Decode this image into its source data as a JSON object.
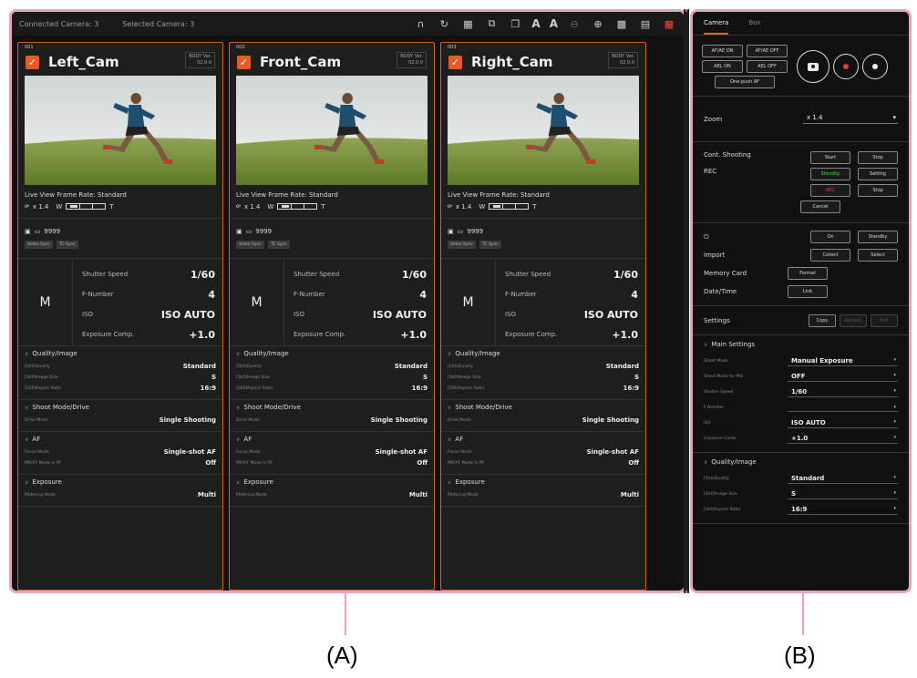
{
  "topbar": {
    "connected": "Connected Camera: 3",
    "selected": "Selected Camera: 3",
    "icons": [
      "headphones-icon",
      "rotate-icon",
      "grid-icon",
      "copy-icon",
      "duplicate-icon",
      "font-size-a-large",
      "font-size-a-small",
      "zoom-out-icon",
      "zoom-in-icon",
      "grid-view-icon",
      "list-view-icon",
      "menu-icon"
    ],
    "font_large": "A",
    "font_small": "A"
  },
  "cameras": [
    {
      "name": "Left_Cam",
      "num": "001",
      "ver1": "BODY Ver.",
      "ver2": "02.0.0",
      "live_view": "Live View Frame Rate: Standard",
      "zoom": "x 1.4",
      "zoom_w": "W",
      "zoom_t": "T",
      "media": "9999",
      "badges": [
        "Video Sync",
        "TC Sync"
      ],
      "mode": "M",
      "exposure": [
        {
          "k": "Shutter Speed",
          "v": "1/60"
        },
        {
          "k": "F-Number",
          "v": "4"
        },
        {
          "k": "ISO",
          "v": "ISO AUTO"
        },
        {
          "k": "Exposure Comp.",
          "v": "+1.0"
        }
      ],
      "sections": [
        {
          "title": "Quality/Image",
          "rows": [
            {
              "k": "[Still]Quality",
              "v": "Standard"
            },
            {
              "k": "[Still]Image Size",
              "v": "S"
            },
            {
              "k": "[Still]Aspect Ratio",
              "v": "16:9"
            }
          ]
        },
        {
          "title": "Shoot Mode/Drive",
          "rows": [
            {
              "k": "Drive Mode",
              "v": "Single Shooting"
            }
          ]
        },
        {
          "title": "AF",
          "rows": [
            {
              "k": "Focus Mode",
              "v": "Single-shot AF"
            },
            {
              "k": "MR/AF Mode in PF",
              "v": "Off"
            }
          ]
        },
        {
          "title": "Exposure",
          "rows": [
            {
              "k": "Metering Mode",
              "v": "Multi"
            }
          ]
        }
      ]
    },
    {
      "name": "Front_Cam",
      "num": "002",
      "ver1": "BODY Ver.",
      "ver2": "02.0.0",
      "live_view": "Live View Frame Rate: Standard",
      "zoom": "x 1.4",
      "zoom_w": "W",
      "zoom_t": "T",
      "media": "9999",
      "badges": [
        "Video Sync",
        "TC Sync"
      ],
      "mode": "M",
      "exposure": [
        {
          "k": "Shutter Speed",
          "v": "1/60"
        },
        {
          "k": "F-Number",
          "v": "4"
        },
        {
          "k": "ISO",
          "v": "ISO AUTO"
        },
        {
          "k": "Exposure Comp.",
          "v": "+1.0"
        }
      ],
      "sections": [
        {
          "title": "Quality/Image",
          "rows": [
            {
              "k": "[Still]Quality",
              "v": "Standard"
            },
            {
              "k": "[Still]Image Size",
              "v": "S"
            },
            {
              "k": "[Still]Aspect Ratio",
              "v": "16:9"
            }
          ]
        },
        {
          "title": "Shoot Mode/Drive",
          "rows": [
            {
              "k": "Drive Mode",
              "v": "Single Shooting"
            }
          ]
        },
        {
          "title": "AF",
          "rows": [
            {
              "k": "Focus Mode",
              "v": "Single-shot AF"
            },
            {
              "k": "MR/AF Mode in PF",
              "v": "Off"
            }
          ]
        },
        {
          "title": "Exposure",
          "rows": [
            {
              "k": "Metering Mode",
              "v": "Multi"
            }
          ]
        }
      ]
    },
    {
      "name": "Right_Cam",
      "num": "003",
      "ver1": "BODY Ver.",
      "ver2": "02.0.0",
      "live_view": "Live View Frame Rate: Standard",
      "zoom": "x 1.4",
      "zoom_w": "W",
      "zoom_t": "T",
      "media": "9999",
      "badges": [
        "Video Sync",
        "TC Sync"
      ],
      "mode": "M",
      "exposure": [
        {
          "k": "Shutter Speed",
          "v": "1/60"
        },
        {
          "k": "F-Number",
          "v": "4"
        },
        {
          "k": "ISO",
          "v": "ISO AUTO"
        },
        {
          "k": "Exposure Comp.",
          "v": "+1.0"
        }
      ],
      "sections": [
        {
          "title": "Quality/Image",
          "rows": [
            {
              "k": "[Still]Quality",
              "v": "Standard"
            },
            {
              "k": "[Still]Image Size",
              "v": "S"
            },
            {
              "k": "[Still]Aspect Ratio",
              "v": "16:9"
            }
          ]
        },
        {
          "title": "Shoot Mode/Drive",
          "rows": [
            {
              "k": "Drive Mode",
              "v": "Single Shooting"
            }
          ]
        },
        {
          "title": "AF",
          "rows": [
            {
              "k": "Focus Mode",
              "v": "Single-shot AF"
            },
            {
              "k": "MR/AF Mode in PF",
              "v": "Off"
            }
          ]
        },
        {
          "title": "Exposure",
          "rows": [
            {
              "k": "Metering Mode",
              "v": "Multi"
            }
          ]
        }
      ]
    }
  ],
  "side": {
    "tabs": [
      "Camera",
      "Box"
    ],
    "ctrl_buttons": [
      "AF/AE ON",
      "AF/AE OFF",
      "AEL ON",
      "AEL OFF"
    ],
    "one_push": "One-push AF",
    "zoom_label": "Zoom",
    "zoom_value": "x 1.4",
    "cont_shooting": "Cont. Shooting",
    "rec": "REC",
    "start": "Start",
    "stop": "Stop",
    "standby": "Standby",
    "setting": "Setting",
    "rec_btn": "REC",
    "stop2": "Stop",
    "cancel": "Cancel",
    "power_on": "On",
    "power_standby": "Standby",
    "import": "Import",
    "collect": "Collect",
    "select": "Select",
    "memory_card": "Memory Card",
    "format": "Format",
    "datetime": "Date/Time",
    "link": "Link",
    "settings": "Settings",
    "copy": "Copy",
    "refresh": "Refresh",
    "edit": "Edit",
    "main_settings": "Main Settings",
    "main_rows": [
      {
        "k": "Shoot Mode",
        "v": "Manual Exposure"
      },
      {
        "k": "Shoot Mode for MO",
        "v": "OFF"
      },
      {
        "k": "Shutter Speed",
        "v": "1/60"
      },
      {
        "k": "F-Number",
        "v": ""
      },
      {
        "k": "ISO",
        "v": "ISO AUTO"
      },
      {
        "k": "Exposure Comp.",
        "v": "+1.0"
      }
    ],
    "quality": "Quality/Image",
    "quality_rows": [
      {
        "k": "[Still]Quality",
        "v": "Standard"
      },
      {
        "k": "[Still]Image Size",
        "v": "S"
      },
      {
        "k": "[Still]Aspect Ratio",
        "v": "16:9"
      }
    ]
  },
  "annotations": {
    "a": "(A)",
    "b": "(B)"
  },
  "colors": {
    "accent": "#e35d2a",
    "frame": "#e7a4c1",
    "bg": "#111111"
  }
}
